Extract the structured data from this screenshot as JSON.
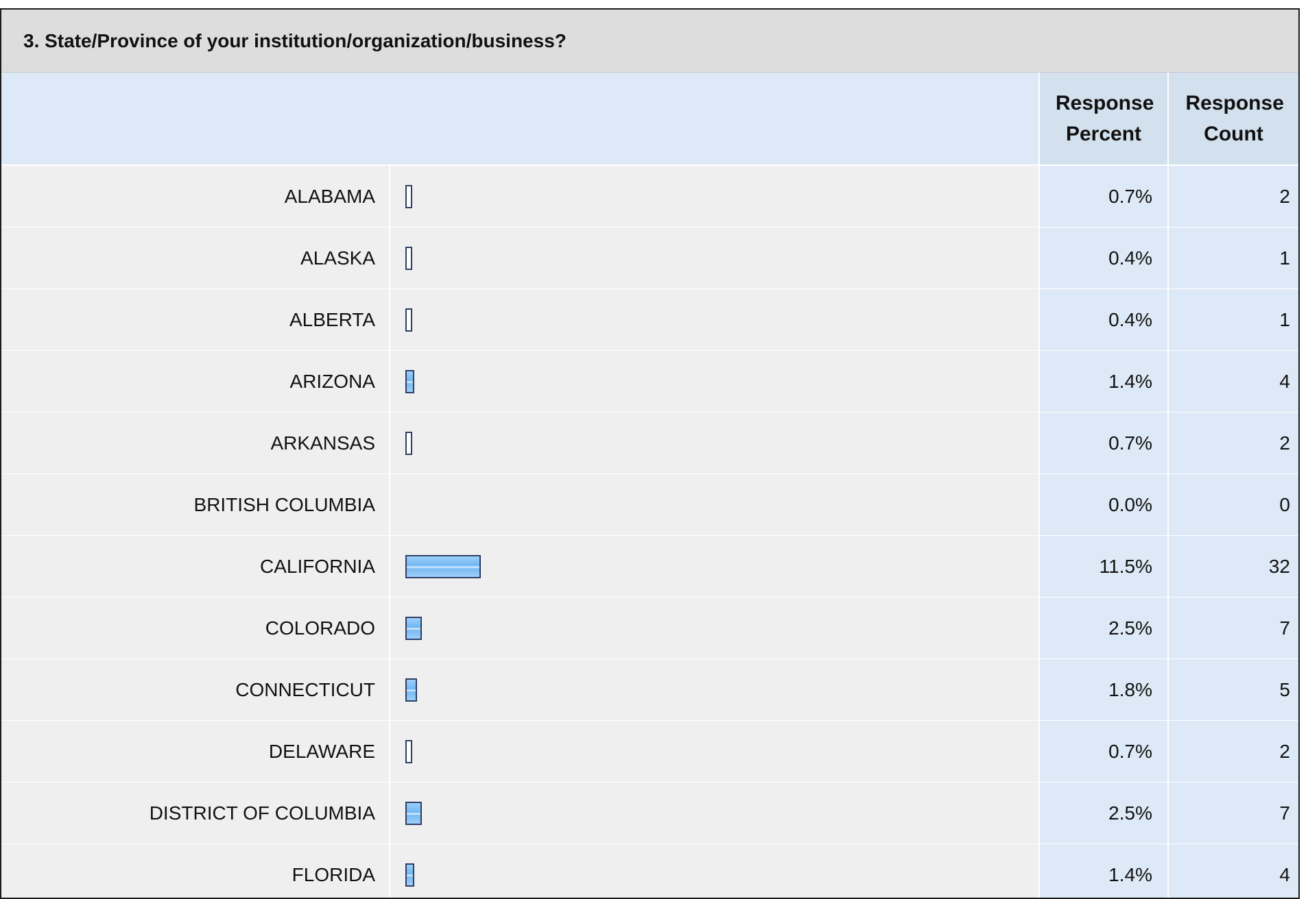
{
  "question": {
    "title": "3. State/Province of your institution/organization/business?"
  },
  "header": {
    "percent_label": "Response Percent",
    "count_label": "Response Count"
  },
  "colors": {
    "bar_fill": "#7ab9f0",
    "bar_border": "#2c3e66",
    "header_bg": "#dddddd",
    "column_bg": "#dde9f6"
  },
  "chart_data": {
    "type": "bar",
    "orientation": "horizontal",
    "title": "3. State/Province of your institution/organization/business?",
    "columns": [
      "Response Percent",
      "Response Count"
    ],
    "categories": [
      "ALABAMA",
      "ALASKA",
      "ALBERTA",
      "ARIZONA",
      "ARKANSAS",
      "BRITISH COLUMBIA",
      "CALIFORNIA",
      "COLORADO",
      "CONNECTICUT",
      "DELAWARE",
      "DISTRICT OF COLUMBIA",
      "FLORIDA"
    ],
    "rows": [
      {
        "label": "ALABAMA",
        "percent": 0.7,
        "percent_text": "0.7%",
        "count": 2
      },
      {
        "label": "ALASKA",
        "percent": 0.4,
        "percent_text": "0.4%",
        "count": 1
      },
      {
        "label": "ALBERTA",
        "percent": 0.4,
        "percent_text": "0.4%",
        "count": 1
      },
      {
        "label": "ARIZONA",
        "percent": 1.4,
        "percent_text": "1.4%",
        "count": 4
      },
      {
        "label": "ARKANSAS",
        "percent": 0.7,
        "percent_text": "0.7%",
        "count": 2
      },
      {
        "label": "BRITISH COLUMBIA",
        "percent": 0.0,
        "percent_text": "0.0%",
        "count": 0
      },
      {
        "label": "CALIFORNIA",
        "percent": 11.5,
        "percent_text": "11.5%",
        "count": 32
      },
      {
        "label": "COLORADO",
        "percent": 2.5,
        "percent_text": "2.5%",
        "count": 7
      },
      {
        "label": "CONNECTICUT",
        "percent": 1.8,
        "percent_text": "1.8%",
        "count": 5
      },
      {
        "label": "DELAWARE",
        "percent": 0.7,
        "percent_text": "0.7%",
        "count": 2
      },
      {
        "label": "DISTRICT OF COLUMBIA",
        "percent": 2.5,
        "percent_text": "2.5%",
        "count": 7
      },
      {
        "label": "FLORIDA",
        "percent": 1.4,
        "percent_text": "1.4%",
        "count": 4
      }
    ],
    "grid": false
  }
}
